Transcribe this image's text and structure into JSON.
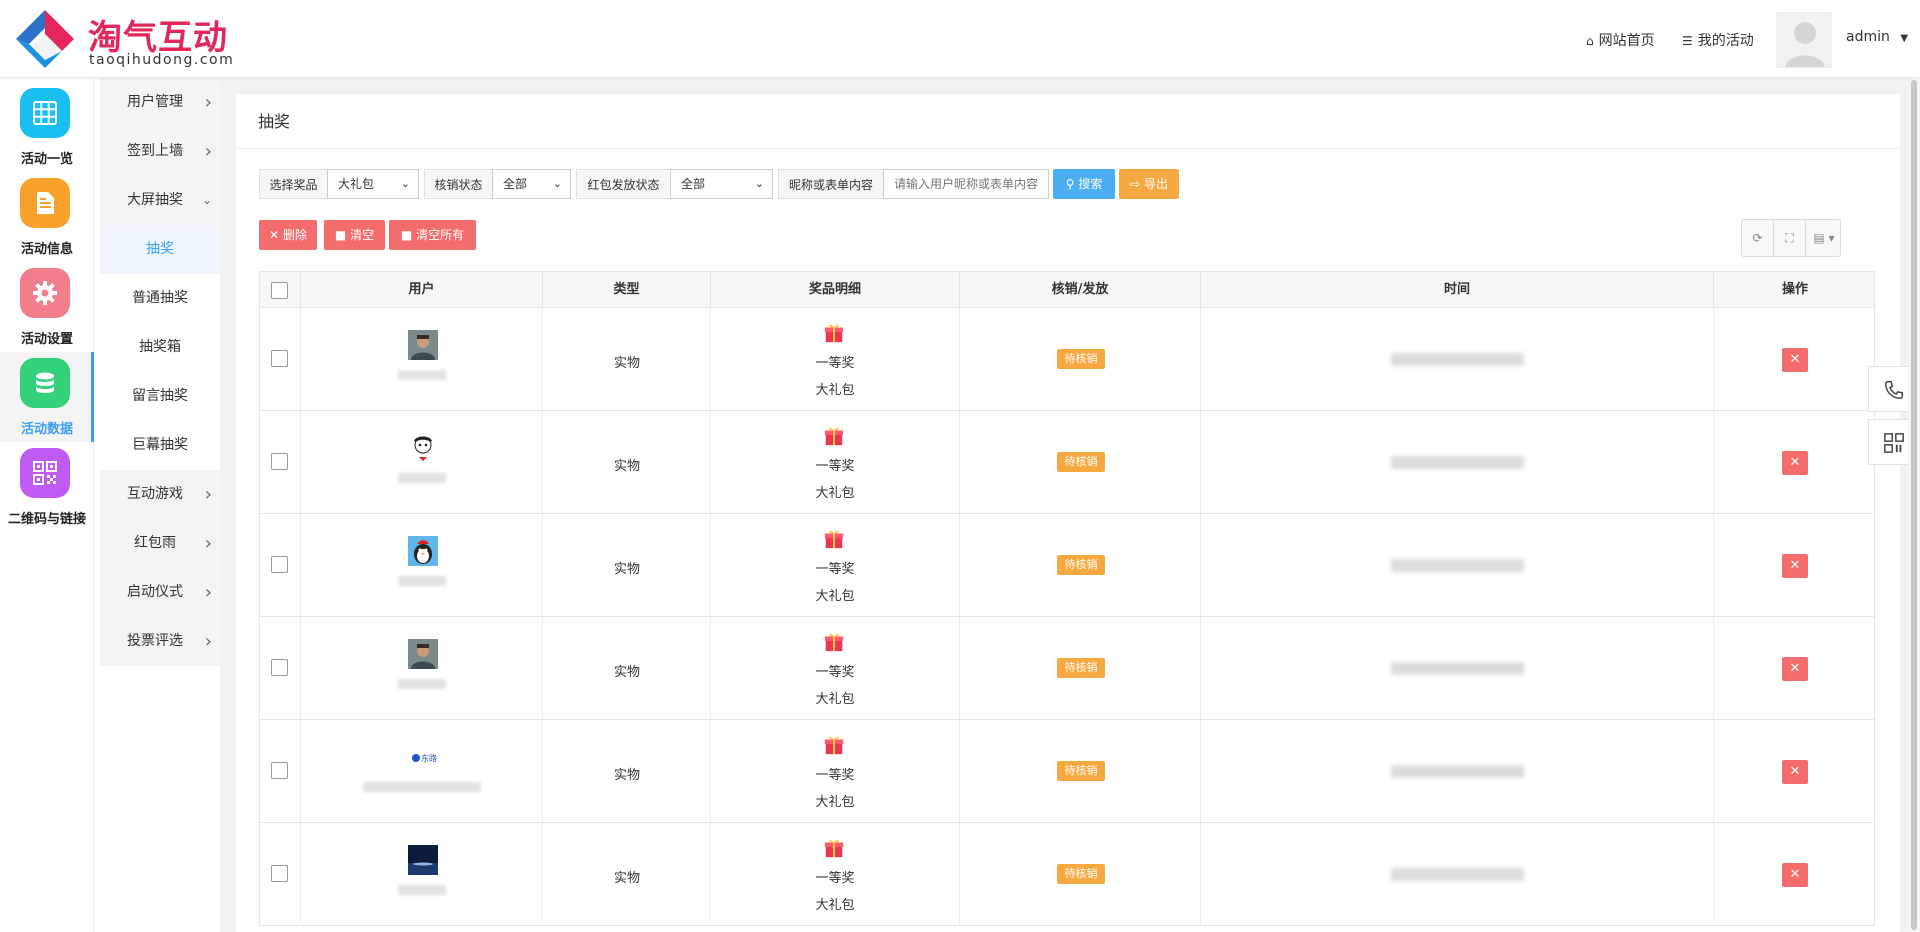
{
  "brand": {
    "name": "淘气互动",
    "domain": "taoqihudong.com"
  },
  "header": {
    "nav_home": "网站首页",
    "nav_my_activity": "我的活动",
    "user": "admin"
  },
  "colors": {
    "accent": "#3b9ff3",
    "warning": "#f7a941",
    "danger": "#f56c6c",
    "primary": "#4baef5",
    "brand": "#e5265a"
  },
  "sidebar_main": [
    {
      "label": "活动一览",
      "icon": "grid-icon",
      "color": "#19bff0"
    },
    {
      "label": "活动信息",
      "icon": "document-icon",
      "color": "#f8a22b"
    },
    {
      "label": "活动设置",
      "icon": "gear-icon",
      "color": "#f27e8c"
    },
    {
      "label": "活动数据",
      "icon": "database-icon",
      "color": "#33d17a",
      "active": true
    },
    {
      "label": "二维码与链接",
      "icon": "qrcode-icon",
      "color": "#bf5af2"
    }
  ],
  "sidebar_sub": [
    {
      "label": "用户管理",
      "chevron": "right"
    },
    {
      "label": "签到上墙",
      "chevron": "right"
    },
    {
      "label": "大屏抽奖",
      "chevron": "down"
    },
    {
      "label": "抽奖",
      "sub": true,
      "active": true
    },
    {
      "label": "普通抽奖",
      "sub": true
    },
    {
      "label": "抽奖箱",
      "sub": true
    },
    {
      "label": "留言抽奖",
      "sub": true
    },
    {
      "label": "巨幕抽奖",
      "sub": true
    },
    {
      "label": "互动游戏",
      "chevron": "right"
    },
    {
      "label": "红包雨",
      "chevron": "right"
    },
    {
      "label": "启动仪式",
      "chevron": "right"
    },
    {
      "label": "投票评选",
      "chevron": "right"
    }
  ],
  "panel": {
    "title": "抽奖"
  },
  "filters": {
    "prize_label": "选择奖品",
    "prize_value": "大礼包",
    "verify_label": "核销状态",
    "verify_value": "全部",
    "redpack_label": "红包发放状态",
    "redpack_value": "全部",
    "keyword_label": "昵称或表单内容",
    "keyword_placeholder": "请输入用户昵称或表单内容",
    "search_btn": "搜索",
    "export_btn": "导出"
  },
  "actions": {
    "delete": "删除",
    "clear": "清空",
    "clear_all": "清空所有"
  },
  "table": {
    "columns": [
      "用户",
      "类型",
      "奖品明细",
      "核销/发放",
      "时间",
      "操作"
    ],
    "rows": [
      {
        "type": "实物",
        "prize_level": "一等奖",
        "prize_name": "大礼包",
        "status": "待核销",
        "avatar": "man-avatar"
      },
      {
        "type": "实物",
        "prize_level": "一等奖",
        "prize_name": "大礼包",
        "status": "待核销",
        "avatar": "cartoon-avatar"
      },
      {
        "type": "实物",
        "prize_level": "一等奖",
        "prize_name": "大礼包",
        "status": "待核销",
        "avatar": "penguin-avatar"
      },
      {
        "type": "实物",
        "prize_level": "一等奖",
        "prize_name": "大礼包",
        "status": "待核销",
        "avatar": "man-avatar"
      },
      {
        "type": "实物",
        "prize_level": "一等奖",
        "prize_name": "大礼包",
        "status": "待核销",
        "avatar": "logo-avatar",
        "avatar_text": "东路"
      },
      {
        "type": "实物",
        "prize_level": "一等奖",
        "prize_name": "大礼包",
        "status": "待核销",
        "avatar": "landscape-avatar"
      }
    ]
  }
}
